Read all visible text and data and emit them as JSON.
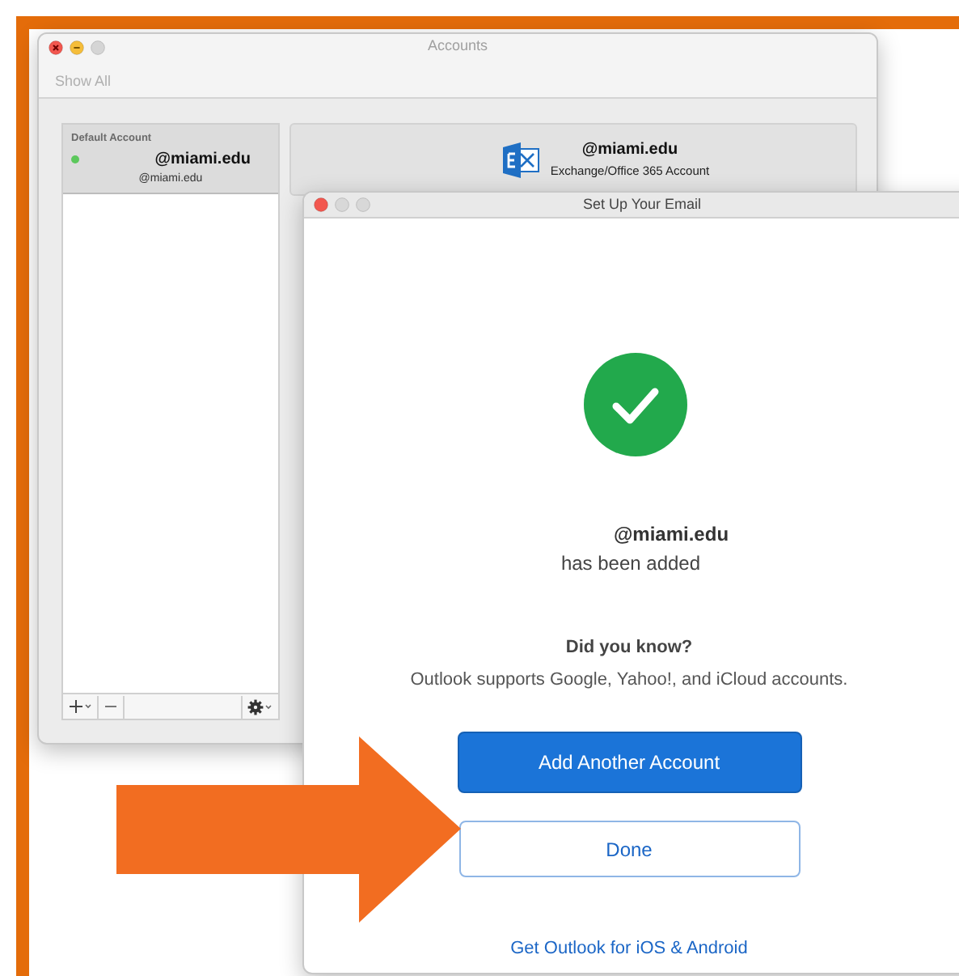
{
  "accounts_window": {
    "title": "Accounts",
    "toolbar": {
      "show_all": "Show All"
    },
    "account_list": {
      "header": "Default Account",
      "items": [
        {
          "name": "@miami.edu",
          "email": "@miami.edu",
          "color": "#5cc85c",
          "selected": true
        }
      ]
    },
    "detail": {
      "name": "@miami.edu",
      "type": "Exchange/Office 365 Account"
    }
  },
  "setup_window": {
    "title": "Set Up Your Email",
    "account": "@miami.edu",
    "added_text": "has been added",
    "tip_title": "Did you know?",
    "tip_text": "Outlook supports Google, Yahoo!, and iCloud accounts.",
    "primary_button": "Add Another Account",
    "secondary_button": "Done",
    "link": "Get Outlook for iOS & Android"
  }
}
